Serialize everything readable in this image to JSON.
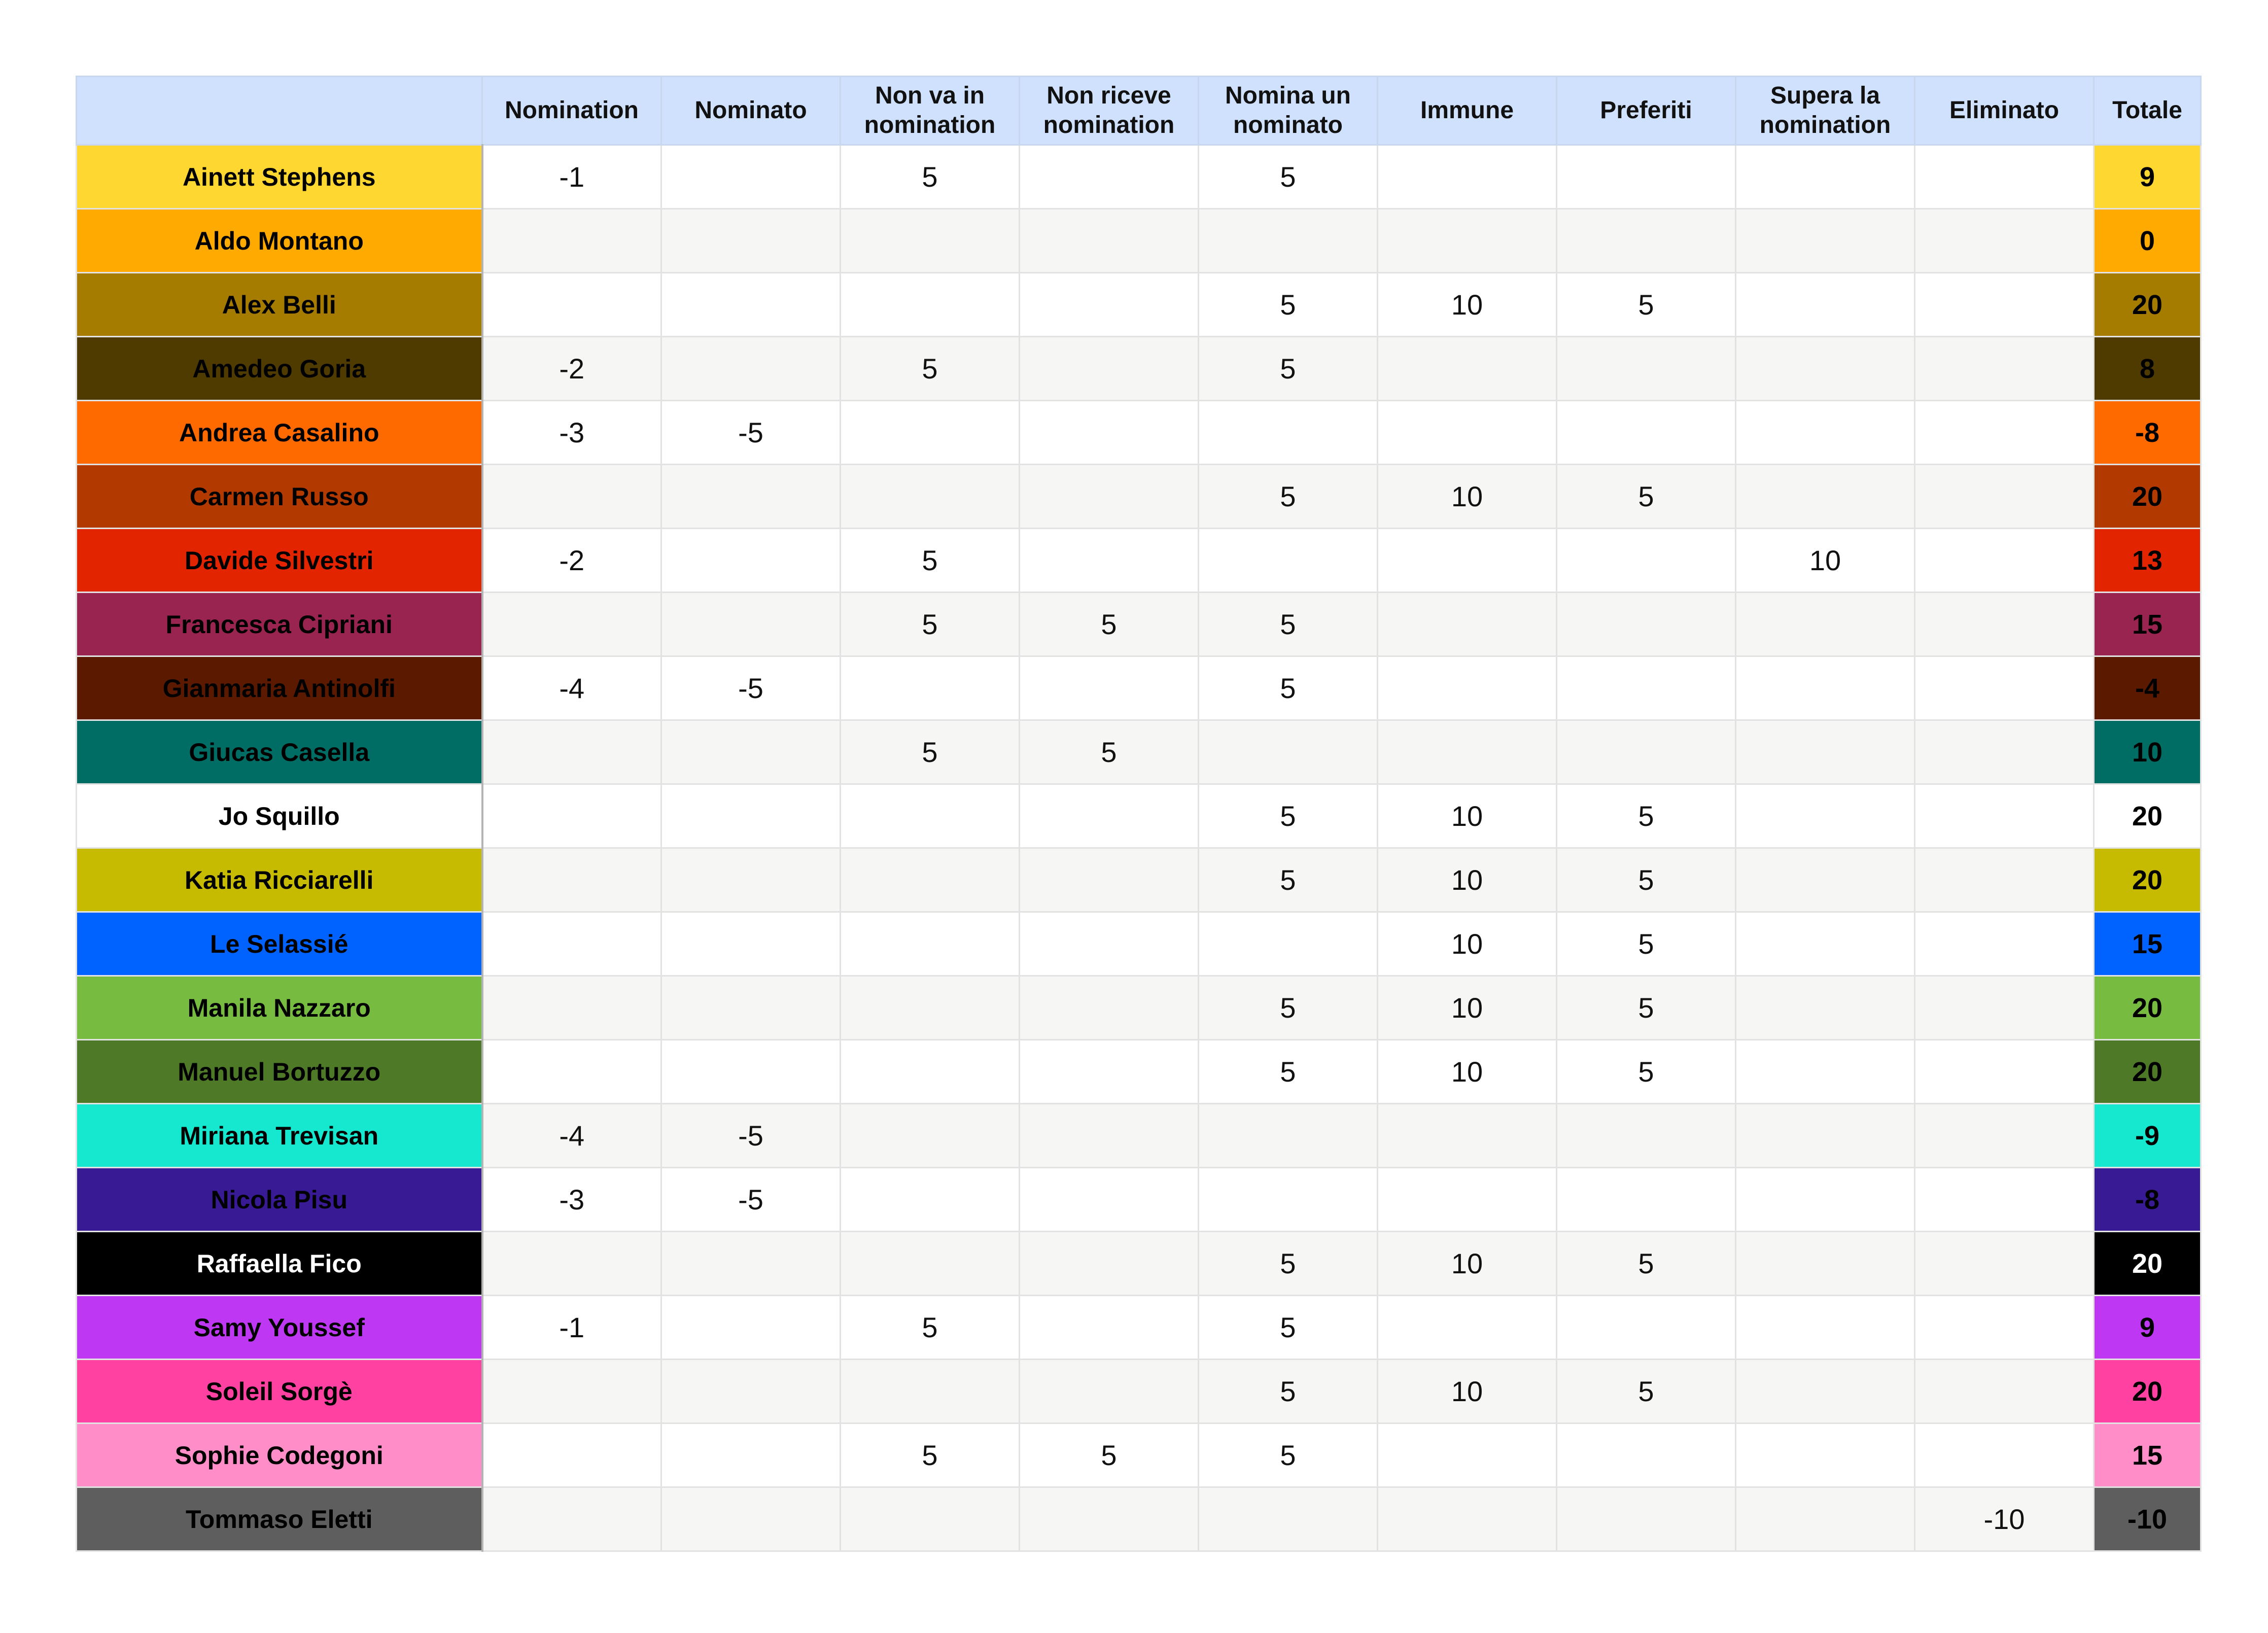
{
  "columns": [
    "",
    "Nomination",
    "Nominato",
    "Non va in nomination",
    "Non riceve nomination",
    "Nomina un nominato",
    "Immune",
    "Preferiti",
    "Supera la nomination",
    "Eliminato",
    "Totale"
  ],
  "rows": [
    {
      "name": "Ainett Stephens",
      "color": "#ffd731",
      "text_color": "#000000",
      "values": [
        "-1",
        "",
        "5",
        "",
        "5",
        "",
        "",
        "",
        ""
      ],
      "total": "9"
    },
    {
      "name": "Aldo Montano",
      "color": "#ffaa00",
      "text_color": "#000000",
      "values": [
        "",
        "",
        "",
        "",
        "",
        "",
        "",
        "",
        ""
      ],
      "total": "0"
    },
    {
      "name": "Alex Belli",
      "color": "#a57b00",
      "text_color": "#000000",
      "values": [
        "",
        "",
        "",
        "",
        "5",
        "10",
        "5",
        "",
        ""
      ],
      "total": "20"
    },
    {
      "name": "Amedeo Goria",
      "color": "#4f3b00",
      "text_color": "#000000",
      "values": [
        "-2",
        "",
        "5",
        "",
        "5",
        "",
        "",
        "",
        ""
      ],
      "total": "8"
    },
    {
      "name": "Andrea Casalino",
      "color": "#ff6a00",
      "text_color": "#000000",
      "values": [
        "-3",
        "-5",
        "",
        "",
        "",
        "",
        "",
        "",
        ""
      ],
      "total": "-8"
    },
    {
      "name": "Carmen Russo",
      "color": "#b23a00",
      "text_color": "#000000",
      "values": [
        "",
        "",
        "",
        "",
        "5",
        "10",
        "5",
        "",
        ""
      ],
      "total": "20"
    },
    {
      "name": "Davide Silvestri",
      "color": "#e22400",
      "text_color": "#000000",
      "values": [
        "-2",
        "",
        "5",
        "",
        "",
        "",
        "",
        "10",
        ""
      ],
      "total": "13"
    },
    {
      "name": "Francesca Cipriani",
      "color": "#99244f",
      "text_color": "#000000",
      "values": [
        "",
        "",
        "5",
        "5",
        "5",
        "",
        "",
        "",
        ""
      ],
      "total": "15"
    },
    {
      "name": "Gianmaria Antinolfi",
      "color": "#5b1a00",
      "text_color": "#000000",
      "values": [
        "-4",
        "-5",
        "",
        "",
        "5",
        "",
        "",
        "",
        ""
      ],
      "total": "-4"
    },
    {
      "name": "Giucas Casella",
      "color": "#006d65",
      "text_color": "#000000",
      "values": [
        "",
        "",
        "5",
        "5",
        "",
        "",
        "",
        "",
        ""
      ],
      "total": "10"
    },
    {
      "name": "Jo Squillo",
      "color": "#ffffff",
      "text_color": "#000000",
      "values": [
        "",
        "",
        "",
        "",
        "5",
        "10",
        "5",
        "",
        ""
      ],
      "total": "20"
    },
    {
      "name": "Katia Ricciarelli",
      "color": "#c6bb00",
      "text_color": "#000000",
      "values": [
        "",
        "",
        "",
        "",
        "5",
        "10",
        "5",
        "",
        ""
      ],
      "total": "20"
    },
    {
      "name": "Le Selassié",
      "color": "#0062ff",
      "text_color": "#000000",
      "values": [
        "",
        "",
        "",
        "",
        "",
        "10",
        "5",
        "",
        ""
      ],
      "total": "15"
    },
    {
      "name": "Manila Nazzaro",
      "color": "#77bb41",
      "text_color": "#000000",
      "values": [
        "",
        "",
        "",
        "",
        "5",
        "10",
        "5",
        "",
        ""
      ],
      "total": "20"
    },
    {
      "name": "Manuel Bortuzzo",
      "color": "#4e7a27",
      "text_color": "#000000",
      "values": [
        "",
        "",
        "",
        "",
        "5",
        "10",
        "5",
        "",
        ""
      ],
      "total": "20"
    },
    {
      "name": "Miriana Trevisan",
      "color": "#16e7cf",
      "text_color": "#000000",
      "values": [
        "-4",
        "-5",
        "",
        "",
        "",
        "",
        "",
        "",
        ""
      ],
      "total": "-9"
    },
    {
      "name": "Nicola Pisu",
      "color": "#371a94",
      "text_color": "#000000",
      "values": [
        "-3",
        "-5",
        "",
        "",
        "",
        "",
        "",
        "",
        ""
      ],
      "total": "-8"
    },
    {
      "name": "Raffaella Fico",
      "color": "#000000",
      "text_color": "#ffffff",
      "values": [
        "",
        "",
        "",
        "",
        "5",
        "10",
        "5",
        "",
        ""
      ],
      "total": "20"
    },
    {
      "name": "Samy Youssef",
      "color": "#be38f3",
      "text_color": "#000000",
      "values": [
        "-1",
        "",
        "5",
        "",
        "5",
        "",
        "",
        "",
        ""
      ],
      "total": "9"
    },
    {
      "name": "Soleil Sorgè",
      "color": "#ff42a1",
      "text_color": "#000000",
      "values": [
        "",
        "",
        "",
        "",
        "5",
        "10",
        "5",
        "",
        ""
      ],
      "total": "20"
    },
    {
      "name": "Sophie Codegoni",
      "color": "#ff8ec8",
      "text_color": "#000000",
      "values": [
        "",
        "",
        "5",
        "5",
        "5",
        "",
        "",
        "",
        ""
      ],
      "total": "15"
    },
    {
      "name": "Tommaso Eletti",
      "color": "#5e5e5e",
      "text_color": "#000000",
      "values": [
        "",
        "",
        "",
        "",
        "",
        "",
        "",
        "",
        "-10"
      ],
      "total": "-10"
    }
  ]
}
